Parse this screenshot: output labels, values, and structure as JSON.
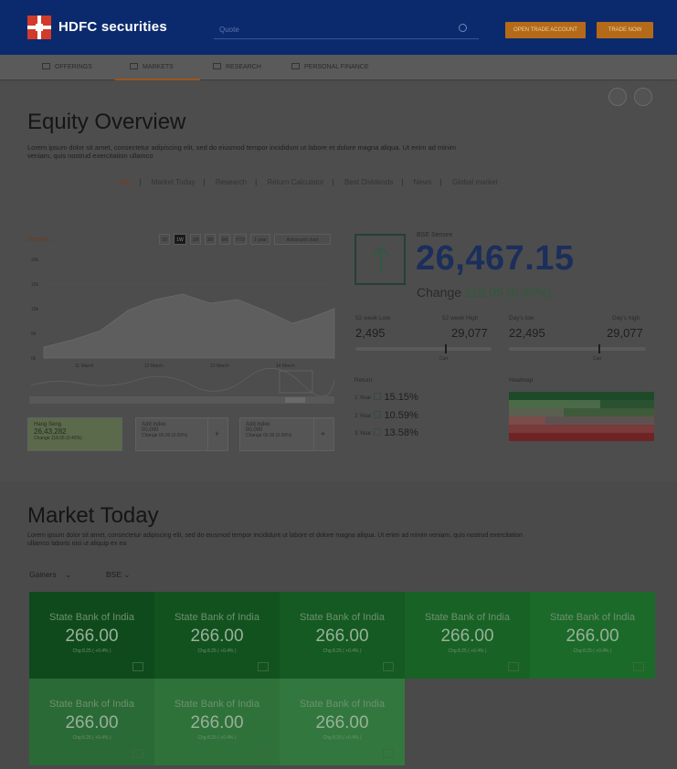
{
  "header": {
    "brand": "HDFC securities",
    "search_placeholder": "Quote",
    "btn_open_account": "OPEN TRADE ACCOUNT",
    "btn_trade_now": "TRADE NOW"
  },
  "nav": {
    "items": [
      {
        "label": "OFFERINGS"
      },
      {
        "label": "MARKETS"
      },
      {
        "label": "RESEARCH"
      },
      {
        "label": "PERSONAL FINANCE"
      }
    ]
  },
  "overview": {
    "title": "Equity Overview",
    "description": "Lorem ipsum dolor sit amet, consectetur adipiscing elit, sed do eiusmod tempor incididunt ut labore et dolore magna aliqua. Ut enim ad minim veniam, quis nostrud exercitation ullamco",
    "sublinks": [
      "Info",
      "Market Today",
      "Research",
      "Return Calculator",
      "Best Dividends",
      "News",
      "Global market"
    ],
    "index_select": "Sensex",
    "ranges": [
      "1D",
      "1W",
      "1M",
      "3M",
      "6M",
      "YTD",
      "1 year",
      "Advanced chart"
    ],
    "y_ticks": [
      "20k",
      "15k",
      "10k",
      "5k",
      "0k"
    ],
    "x_ticks": [
      "11 March",
      "12 March",
      "13 March",
      "14 March"
    ],
    "cards": [
      {
        "title": "Hang Seng",
        "value": "26,43,282",
        "change": "Change 118.05 (0.45%)"
      },
      {
        "title": "Add index",
        "value": "00,000",
        "change": "Change 00.00 (0.00%)"
      },
      {
        "title": "Add index",
        "value": "00,000",
        "change": "Change 00.00 (0.00%)"
      }
    ],
    "ticker": {
      "label": "BSE Sensex",
      "value": "26,467.15",
      "change_prefix": "Change",
      "change_value": "118.05",
      "change_pct": "(0.45%)"
    },
    "range52": {
      "low_label": "52 week Low",
      "low": "2,495",
      "high_label": "52 week High",
      "high": "29,077",
      "marker": "Curr"
    },
    "day_range": {
      "low_label": "Day's low",
      "low": "22,495",
      "high_label": "Day's high",
      "high": "29,077",
      "marker": "Curr"
    },
    "returns": {
      "title": "Return",
      "rows": [
        {
          "period": "1 Year",
          "pct": "15.15%"
        },
        {
          "period": "2 Year",
          "pct": "10.59%"
        },
        {
          "period": "3 Year",
          "pct": "13.58%"
        }
      ]
    },
    "heatmap_title": "Heatmap",
    "colors": {
      "accent_orange": "#b46a18",
      "navy": "#0b2a6e",
      "green_tile": "#1b6a2a"
    }
  },
  "market_today": {
    "title": "Market Today",
    "description": "Lorem ipsum dolor sit amet, consectetur adipiscing elit, sed do eiusmod tempor incididunt ut labore et dolore magna aliqua. Ut enim ad minim veniam, quis nostrud exercitation ullamco laboris nisi ut aliquip ex ea",
    "filter1": "Gainers",
    "filter2": "BSE",
    "tiles": [
      {
        "name": "State Bank of India",
        "price": "266.00",
        "change": "Chg 8.25 ( +0.4% )"
      },
      {
        "name": "State Bank of India",
        "price": "266.00",
        "change": "Chg 8.25 ( +0.4% )"
      },
      {
        "name": "State Bank of India",
        "price": "266.00",
        "change": "Chg 8.25 ( +0.4% )"
      },
      {
        "name": "State Bank of India",
        "price": "266.00",
        "change": "Chg 8.25 ( +0.4% )"
      },
      {
        "name": "State Bank of India",
        "price": "266.00",
        "change": "Chg 8.25 ( +0.4% )"
      },
      {
        "name": "State Bank of India",
        "price": "266.00",
        "change": "Chg 8.25 ( +0.4% )"
      },
      {
        "name": "State Bank of India",
        "price": "266.00",
        "change": "Chg 8.25 ( +0.4% )"
      },
      {
        "name": "State Bank of India",
        "price": "266.00",
        "change": "Chg 8.25 ( +0.4% )"
      }
    ]
  }
}
